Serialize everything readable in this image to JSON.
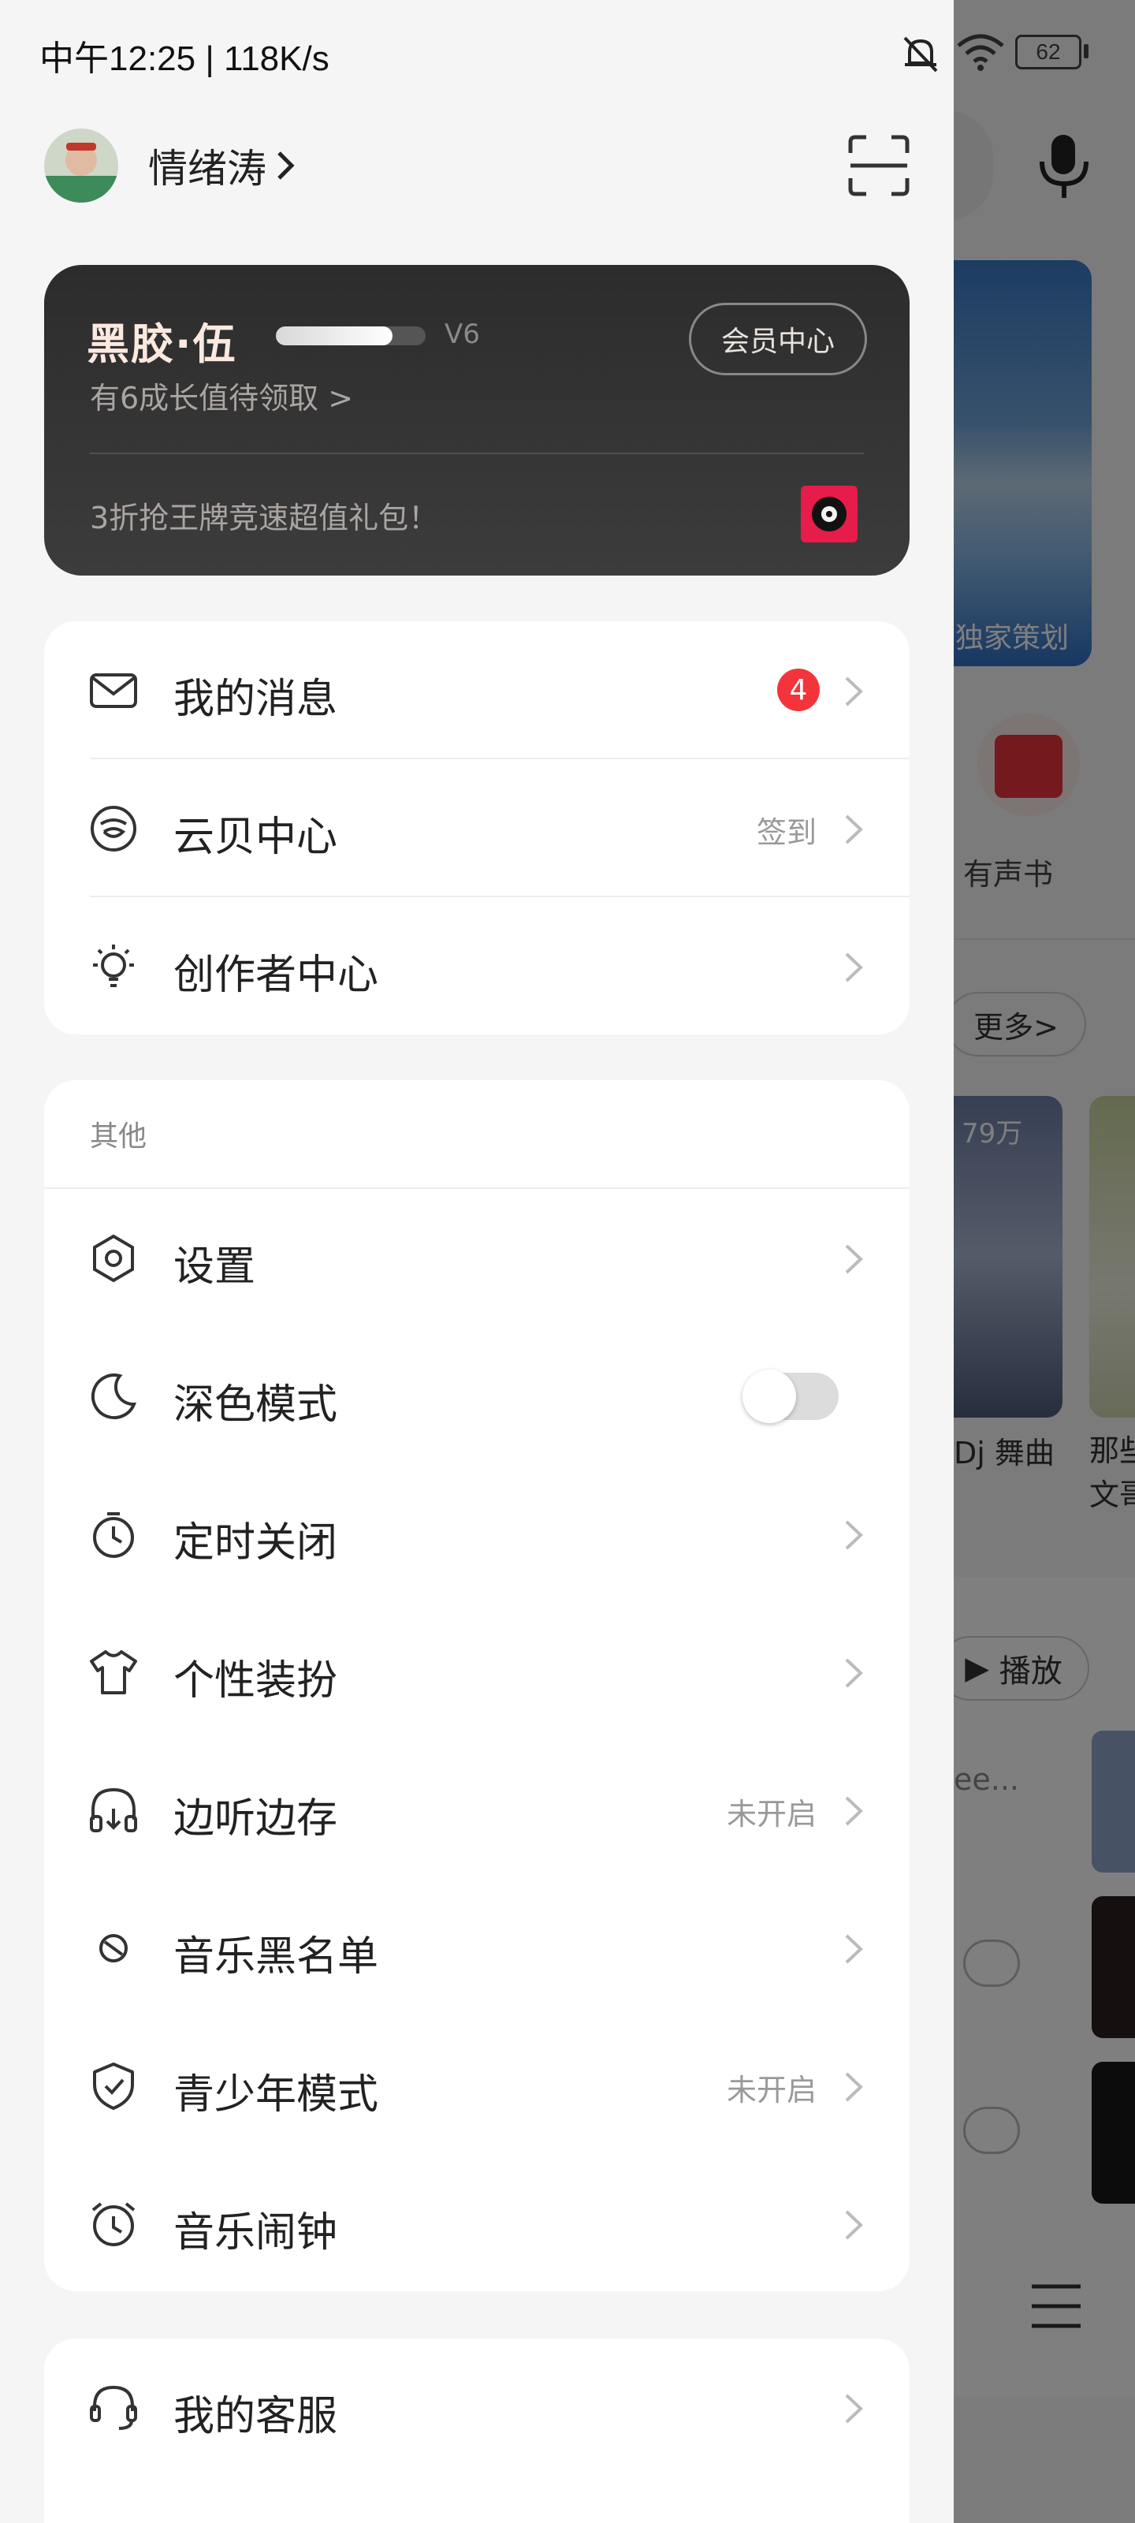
{
  "status_bar": {
    "time_speed": "中午12:25 | 118K/s",
    "battery": "62"
  },
  "user": {
    "name": "情绪涛"
  },
  "vip": {
    "title": "黑胶·伍",
    "level": "V6",
    "progress": 0.78,
    "center_button": "会员中心",
    "growth_text": "有6成长值待领取 >",
    "promo_text": "3折抢王牌竞速超值礼包！"
  },
  "menu_group_1": {
    "items": [
      {
        "label": "我的消息",
        "icon": "mail-icon",
        "badge": "4"
      },
      {
        "label": "云贝中心",
        "icon": "cloud-shell-icon",
        "value": "签到"
      },
      {
        "label": "创作者中心",
        "icon": "lightbulb-icon"
      }
    ]
  },
  "menu_group_2": {
    "section_title": "其他",
    "items": [
      {
        "label": "设置",
        "icon": "settings-hexagon-icon"
      },
      {
        "label": "深色模式",
        "icon": "moon-icon",
        "toggle_on": false
      },
      {
        "label": "定时关闭",
        "icon": "timer-icon"
      },
      {
        "label": "个性装扮",
        "icon": "tshirt-icon"
      },
      {
        "label": "边听边存",
        "icon": "headphones-download-icon",
        "value": "未开启"
      },
      {
        "label": "音乐黑名单",
        "icon": "block-icon"
      },
      {
        "label": "青少年模式",
        "icon": "shield-check-icon",
        "value": "未开启"
      },
      {
        "label": "音乐闹钟",
        "icon": "alarm-clock-icon"
      }
    ]
  },
  "menu_group_3": {
    "items": [
      {
        "label": "我的客服",
        "icon": "headset-icon"
      }
    ]
  },
  "background": {
    "banner_text": "独家策划",
    "audiobook_label": "有声书",
    "more_button": "更多>",
    "card_count": "79万",
    "dj_label": "Dj 舞曲",
    "partial_title": "那些\n文哥",
    "play_button": "播放",
    "ellipsis_text": "ee..."
  },
  "colors": {
    "accent_red": "#f4343b",
    "vip_card": "#2c2c2c",
    "drawer_bg": "#f5f5f5"
  }
}
